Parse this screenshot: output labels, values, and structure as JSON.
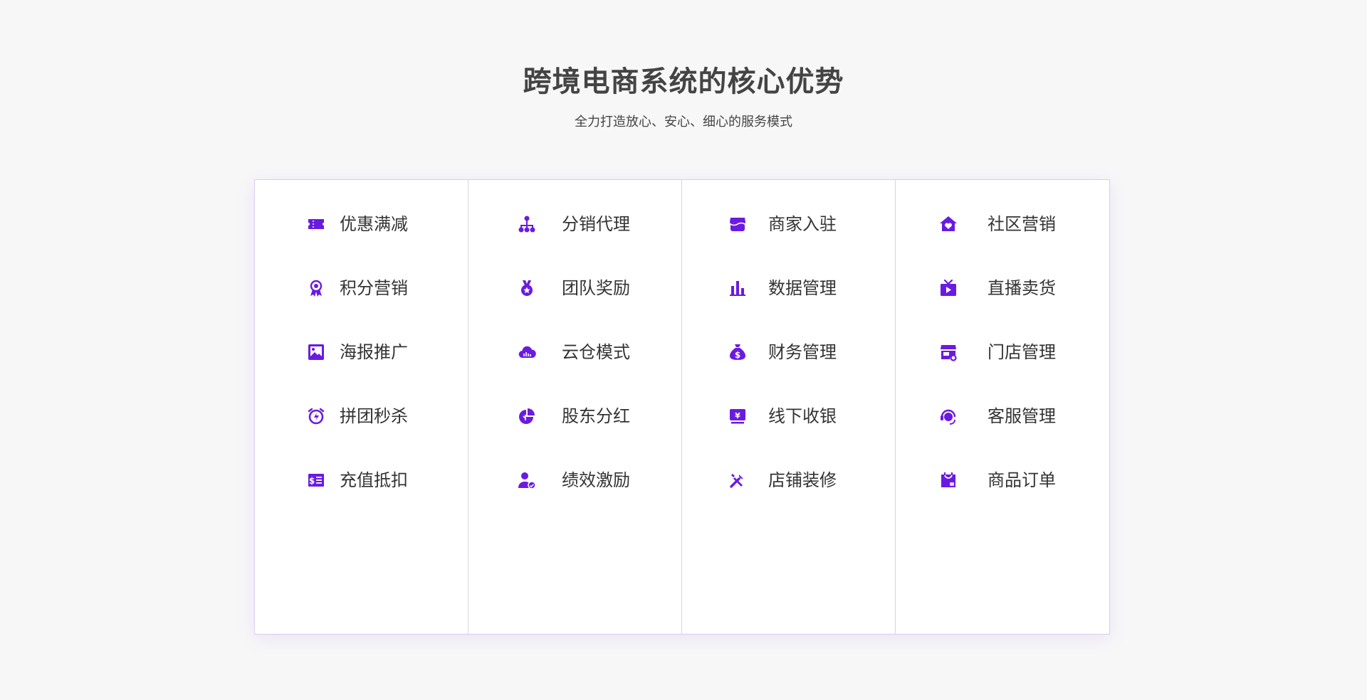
{
  "header": {
    "title": "跨境电商系统的核心优势",
    "subtitle": "全力打造放心、安心、细心的服务模式"
  },
  "accent_color": "#6a1be0",
  "columns": [
    {
      "items": [
        {
          "label": "优惠满减",
          "icon": "coupon-icon"
        },
        {
          "label": "积分营销",
          "icon": "award-ribbon-icon"
        },
        {
          "label": "海报推广",
          "icon": "image-poster-icon"
        },
        {
          "label": "拼团秒杀",
          "icon": "alarm-clock-icon"
        },
        {
          "label": "充值抵扣",
          "icon": "recharge-receipt-icon"
        }
      ]
    },
    {
      "items": [
        {
          "label": "分销代理",
          "icon": "org-tree-icon"
        },
        {
          "label": "团队奖励",
          "icon": "medal-icon"
        },
        {
          "label": "云仓模式",
          "icon": "cloud-warehouse-icon"
        },
        {
          "label": "股东分红",
          "icon": "pie-chart-icon"
        },
        {
          "label": "绩效激励",
          "icon": "user-performance-icon"
        }
      ]
    },
    {
      "items": [
        {
          "label": "商家入驻",
          "icon": "storefront-icon"
        },
        {
          "label": "数据管理",
          "icon": "bar-chart-icon"
        },
        {
          "label": "财务管理",
          "icon": "money-bag-icon"
        },
        {
          "label": "线下收银",
          "icon": "cashier-icon"
        },
        {
          "label": "店铺装修",
          "icon": "tools-icon"
        }
      ]
    },
    {
      "items": [
        {
          "label": "社区营销",
          "icon": "house-heart-icon"
        },
        {
          "label": "直播卖货",
          "icon": "live-tv-icon"
        },
        {
          "label": "门店管理",
          "icon": "store-settings-icon"
        },
        {
          "label": "客服管理",
          "icon": "headset-service-icon"
        },
        {
          "label": "商品订单",
          "icon": "shopping-bag-icon"
        }
      ]
    }
  ]
}
